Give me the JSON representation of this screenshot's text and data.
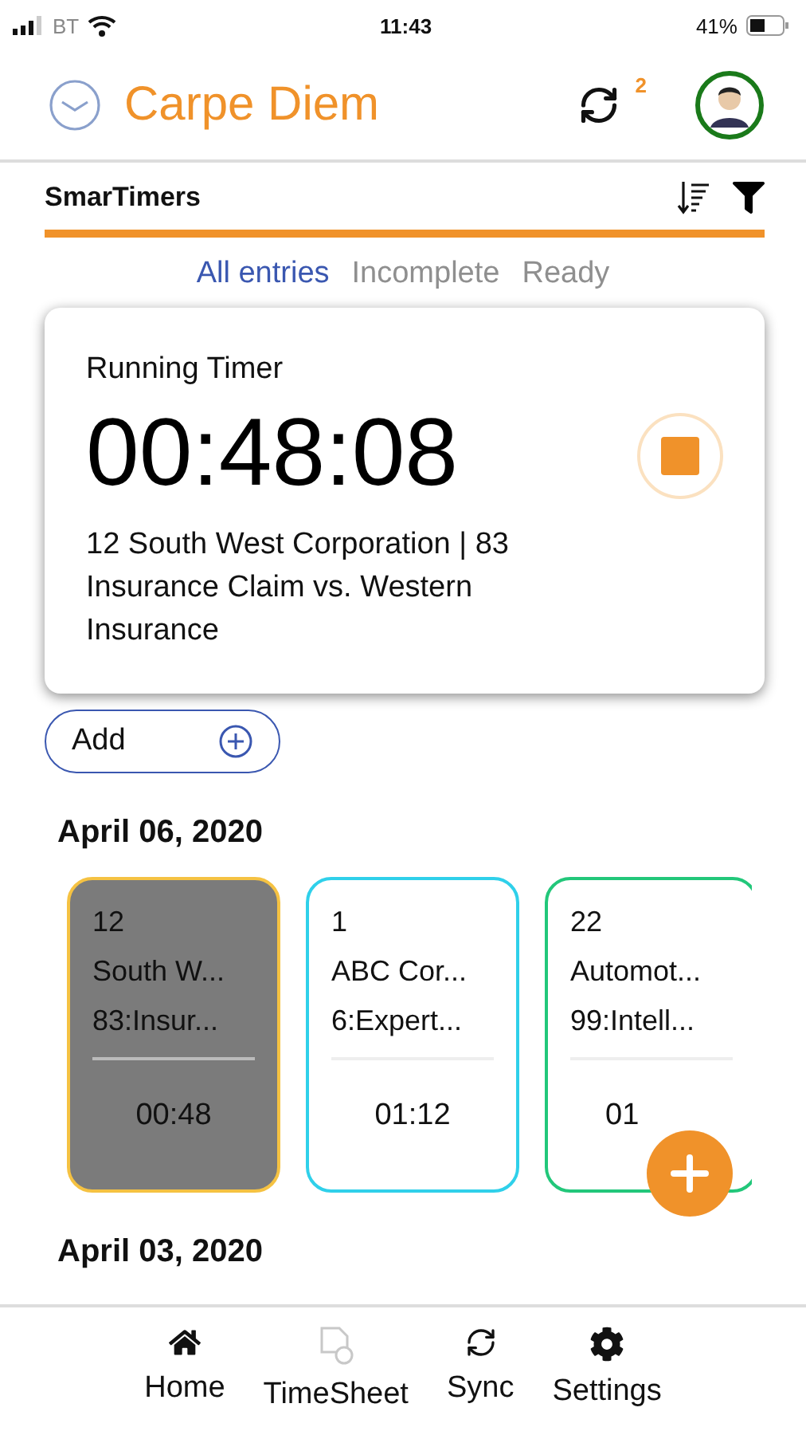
{
  "status_bar": {
    "carrier": "BT",
    "time": "11:43",
    "battery": "41%"
  },
  "header": {
    "title": "Carpe Diem",
    "sync_count": "2"
  },
  "section": {
    "title": "SmarTimers"
  },
  "filters": [
    {
      "label": "All entries",
      "selected": true
    },
    {
      "label": "Incomplete",
      "selected": false
    },
    {
      "label": "Ready",
      "selected": false
    }
  ],
  "running_timer": {
    "label": "Running Timer",
    "time": "00:48:08",
    "description": "12 South West Corporation | 83 Insurance Claim vs. Western Insurance"
  },
  "add_button": {
    "label": "Add"
  },
  "days": [
    {
      "date": "April 06, 2020",
      "entries": [
        {
          "number": "12",
          "client": "South W...",
          "matter": "83:Insur...",
          "duration": "00:48",
          "running": true,
          "color": "#f5c242"
        },
        {
          "number": "1",
          "client": "ABC Cor...",
          "matter": "6:Expert...",
          "duration": "01:12",
          "running": false,
          "color": "#2fd0ea"
        },
        {
          "number": "22",
          "client": "Automot...",
          "matter": "99:Intell...",
          "duration": "01",
          "running": false,
          "color": "#22c77a"
        }
      ]
    },
    {
      "date": "April 03, 2020"
    }
  ],
  "nav": [
    {
      "label": "Home",
      "disabled": false
    },
    {
      "label": "TimeSheet",
      "disabled": true
    },
    {
      "label": "Sync",
      "disabled": false
    },
    {
      "label": "Settings",
      "disabled": false
    }
  ]
}
